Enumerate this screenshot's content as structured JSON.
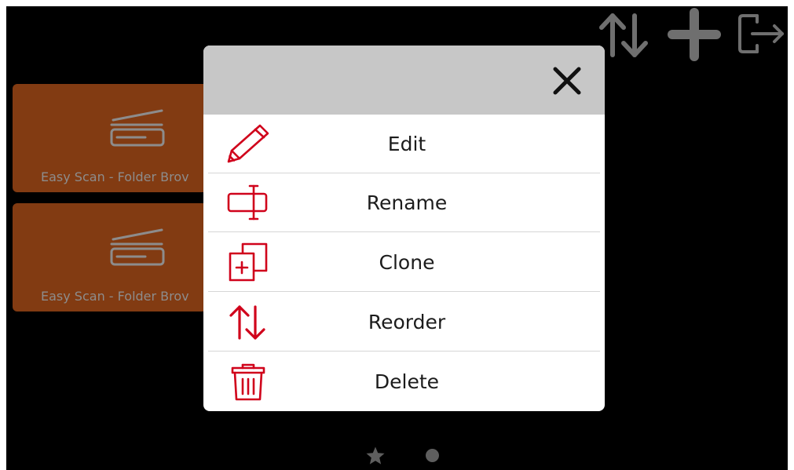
{
  "tiles": [
    {
      "label": "Easy Scan - Folder Brov",
      "icon": "scanner-icon"
    },
    {
      "label": "Easy Scan - Folder Brov",
      "icon": "scanner-icon"
    }
  ],
  "toolbar": {
    "icons": [
      "reorder-icon",
      "add-icon",
      "sign-out-icon"
    ]
  },
  "context_menu": {
    "close_icon": "close-icon",
    "items": [
      {
        "label": "Edit",
        "icon": "pencil-icon"
      },
      {
        "label": "Rename",
        "icon": "rename-icon"
      },
      {
        "label": "Clone",
        "icon": "clone-icon"
      },
      {
        "label": "Reorder",
        "icon": "reorder-icon"
      },
      {
        "label": "Delete",
        "icon": "trash-icon"
      }
    ]
  },
  "pagination": {
    "pages": [
      "favorites-star-icon",
      "page-dot"
    ]
  },
  "colors": {
    "background": "#000000",
    "tile": "#823b12",
    "tile_text": "#8d8c8c",
    "toolbar_icon": "#6f6f6f",
    "menu_accent": "#d0021b",
    "modal_header": "#c7c7c7"
  }
}
